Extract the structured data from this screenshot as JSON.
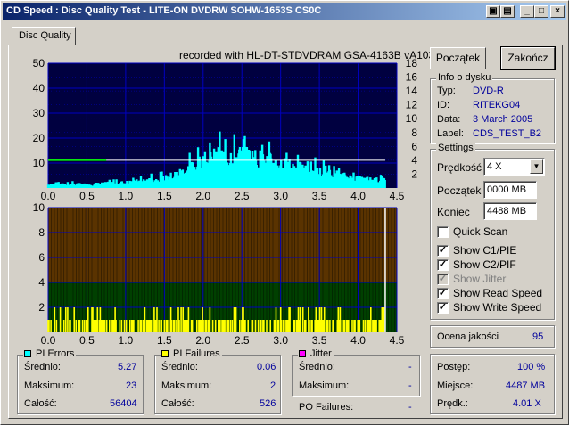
{
  "title": "CD Speed : Disc Quality Test - LITE-ON DVDRW SOHW-1653S CS0C",
  "tab": "Disc Quality",
  "recorded": "recorded with HL-DT-STDVDRAM GSA-4163B vA103",
  "buttons": {
    "start": "Początek",
    "end": "Zakończ"
  },
  "info": {
    "caption": "Info o dysku",
    "rows": [
      {
        "label": "Typ:",
        "value": "DVD-R"
      },
      {
        "label": "ID:",
        "value": "RITEKG04"
      },
      {
        "label": "Data:",
        "value": "3 March 2005"
      },
      {
        "label": "Label:",
        "value": "CDS_TEST_B2"
      }
    ]
  },
  "settings": {
    "caption": "Settings",
    "speed_label": "Prędkość",
    "speed_value": "4 X",
    "start_label": "Początek",
    "start_value": "0000 MB",
    "end_label": "Koniec",
    "end_value": "4488 MB",
    "checks": [
      {
        "label": "Quick Scan",
        "checked": false,
        "disabled": false
      },
      {
        "label": "Show C1/PIE",
        "checked": true,
        "disabled": false
      },
      {
        "label": "Show C2/PIF",
        "checked": true,
        "disabled": false
      },
      {
        "label": "Show Jitter",
        "checked": true,
        "disabled": true
      },
      {
        "label": "Show Read Speed",
        "checked": true,
        "disabled": false
      },
      {
        "label": "Show Write Speed",
        "checked": true,
        "disabled": false
      }
    ]
  },
  "quality": {
    "label": "Ocena jakości",
    "value": "95"
  },
  "progress": {
    "rows": [
      {
        "label": "Postęp:",
        "value": "100 %"
      },
      {
        "label": "Miejsce:",
        "value": "4487 MB"
      },
      {
        "label": "Prędk.:",
        "value": "4.01 X"
      }
    ]
  },
  "pi_errors": {
    "caption": "PI Errors",
    "color": "#00ffff",
    "rows": [
      {
        "label": "Średnio:",
        "value": "5.27"
      },
      {
        "label": "Maksimum:",
        "value": "23"
      },
      {
        "label": "Całość:",
        "value": "56404"
      }
    ]
  },
  "pi_failures": {
    "caption": "PI Failures",
    "color": "#ffff00",
    "rows": [
      {
        "label": "Średnio:",
        "value": "0.06"
      },
      {
        "label": "Maksimum:",
        "value": "2"
      },
      {
        "label": "Całość:",
        "value": "526"
      }
    ]
  },
  "jitter": {
    "caption": "Jitter",
    "color": "#ff00ff",
    "rows": [
      {
        "label": "Średnio:",
        "value": "-"
      },
      {
        "label": "Maksimum:",
        "value": "-"
      }
    ]
  },
  "po_failures": {
    "label": "PO Failures:",
    "value": "-"
  },
  "chart_data": [
    {
      "type": "area",
      "xlim": [
        0,
        4.5
      ],
      "ylim": [
        0,
        50
      ],
      "y_ticks": [
        "10",
        "20",
        "30",
        "40",
        "50"
      ],
      "y2_ticks": [
        "2",
        "4",
        "6",
        "8",
        "10",
        "12",
        "14",
        "16",
        "18"
      ],
      "x_ticks": [
        "0.0",
        "0.5",
        "1.0",
        "1.5",
        "2.0",
        "2.5",
        "3.0",
        "3.5",
        "4.0",
        "4.5"
      ],
      "colors": {
        "background": "#000040",
        "grid": "#0000c0",
        "pie": "#00ffff",
        "read_speed": "#ffffff",
        "write_speed": "#00ff00"
      },
      "pie_envelope": {
        "x": [
          0,
          0.5,
          1.0,
          1.5,
          1.8,
          2.0,
          2.2,
          2.5,
          2.8,
          3.0,
          3.3,
          3.6,
          4.0,
          4.35
        ],
        "y": [
          2,
          2,
          3,
          5,
          10,
          14,
          17,
          18,
          15,
          13,
          10,
          8,
          5,
          4
        ]
      },
      "read_speed": {
        "x": [
          0,
          4.35
        ],
        "y": [
          4.0,
          4.0
        ]
      },
      "write_speed": {
        "x": [
          0,
          0.75
        ],
        "y": [
          4.0,
          4.0
        ]
      }
    },
    {
      "type": "bar",
      "xlim": [
        0,
        4.5
      ],
      "ylim": [
        0,
        10
      ],
      "y_ticks": [
        "2",
        "4",
        "6",
        "8",
        "10"
      ],
      "x_ticks": [
        "0.0",
        "0.5",
        "1.0",
        "1.5",
        "2.0",
        "2.5",
        "3.0",
        "3.5",
        "4.0",
        "4.5"
      ],
      "colors": {
        "upper": "#5a3300",
        "lower": "#004000",
        "grid": "#0000c0",
        "pif": "#ffff00"
      },
      "zone_split": 4,
      "pif_max": 2
    }
  ]
}
